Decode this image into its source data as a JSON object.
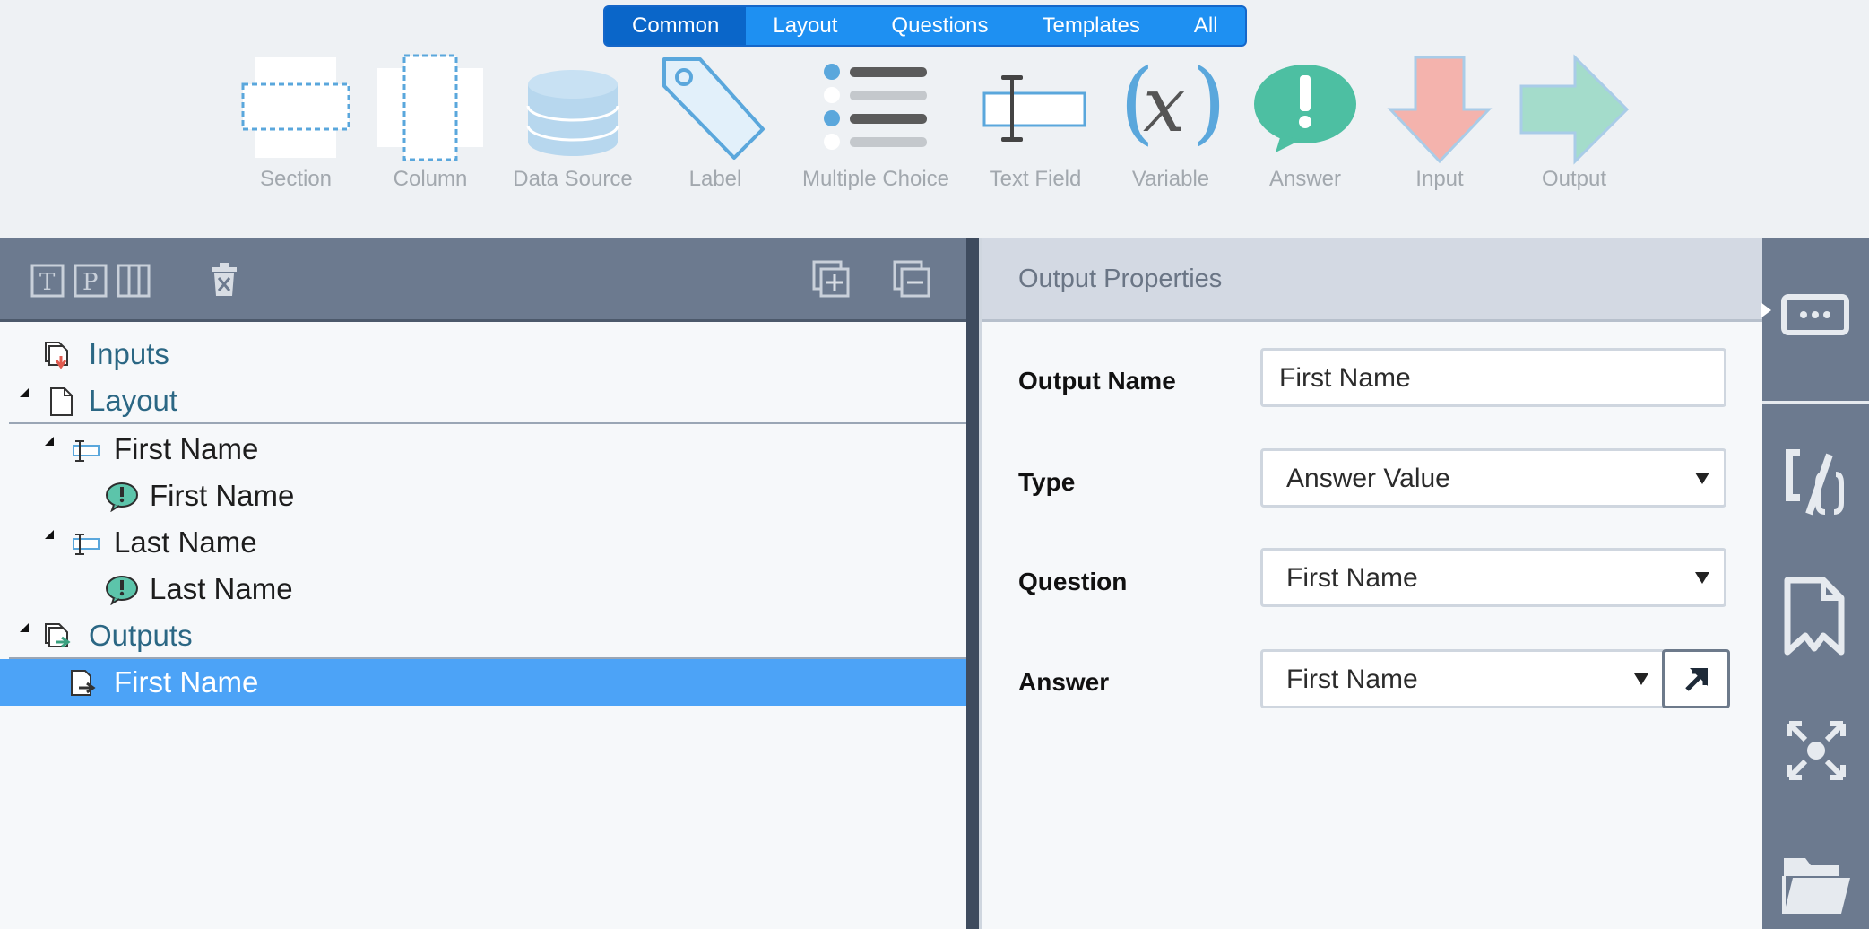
{
  "toolbox": {
    "tabs": [
      {
        "label": "Common",
        "active": true
      },
      {
        "label": "Layout",
        "active": false
      },
      {
        "label": "Questions",
        "active": false
      },
      {
        "label": "Templates",
        "active": false
      },
      {
        "label": "All",
        "active": false
      }
    ],
    "tools": [
      {
        "label": "Section",
        "icon": "section-icon"
      },
      {
        "label": "Column",
        "icon": "column-icon"
      },
      {
        "label": "Data Source",
        "icon": "database-icon"
      },
      {
        "label": "Label",
        "icon": "tag-icon"
      },
      {
        "label": "Multiple Choice",
        "icon": "list-icon"
      },
      {
        "label": "Text Field",
        "icon": "text-field-icon"
      },
      {
        "label": "Variable",
        "icon": "variable-icon"
      },
      {
        "label": "Answer",
        "icon": "speech-bubble-icon"
      },
      {
        "label": "Input",
        "icon": "arrow-down-icon"
      },
      {
        "label": "Output",
        "icon": "arrow-right-icon"
      }
    ]
  },
  "left_toolbar": {
    "buttons": [
      "text-mode-icon",
      "prompt-mode-icon",
      "column-mode-icon",
      "delete-icon",
      "expand-all-icon",
      "collapse-all-icon"
    ]
  },
  "tree": {
    "items": [
      {
        "label": "Inputs",
        "icon": "inputs-icon",
        "group": true
      },
      {
        "label": "Layout",
        "icon": "page-icon",
        "group": true,
        "expanded": true
      },
      {
        "label": "First Name",
        "icon": "text-field-icon",
        "expanded": true
      },
      {
        "label": "First Name",
        "icon": "answer-icon"
      },
      {
        "label": "Last Name",
        "icon": "text-field-icon",
        "expanded": true
      },
      {
        "label": "Last Name",
        "icon": "answer-icon"
      },
      {
        "label": "Outputs",
        "icon": "outputs-icon",
        "group": true,
        "expanded": true
      },
      {
        "label": "First Name",
        "icon": "output-icon",
        "selected": true
      }
    ]
  },
  "props": {
    "title": "Output Properties",
    "output_name": {
      "label": "Output Name",
      "value": "First Name"
    },
    "type": {
      "label": "Type",
      "value": "Answer Value"
    },
    "question": {
      "label": "Question",
      "value": "First Name"
    },
    "answer": {
      "label": "Answer",
      "value": "First Name"
    }
  },
  "rail": {
    "buttons": [
      "textbox-icon",
      "code-icon",
      "bookmark-icon",
      "arrange-icon",
      "folder-icon"
    ]
  },
  "colors": {
    "accent": "#1e90f2",
    "selection": "#4ca3f7",
    "toolbar": "#6c7a8f"
  }
}
